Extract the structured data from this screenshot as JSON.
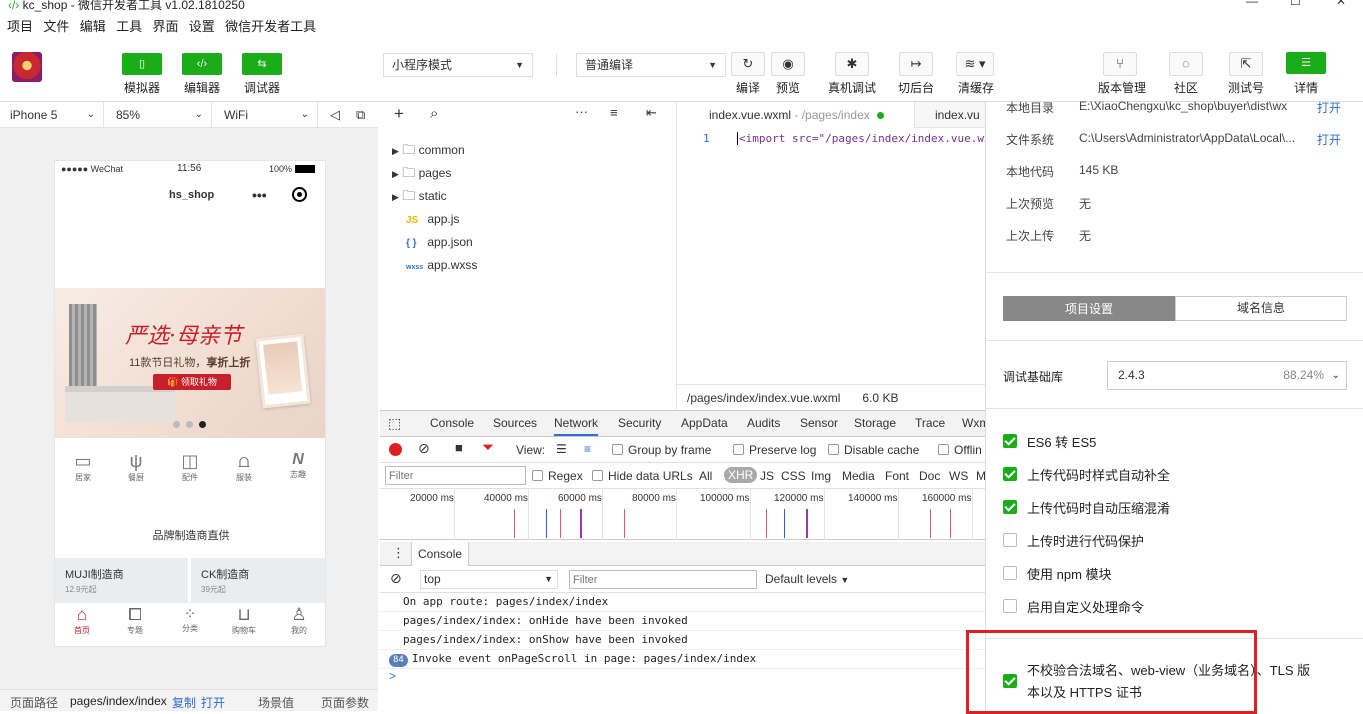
{
  "window": {
    "title": "kc_shop - 微信开发者工具 v1.02.1810250"
  },
  "menu": [
    "项目",
    "文件",
    "编辑",
    "工具",
    "界面",
    "设置",
    "微信开发者工具"
  ],
  "toolbar": {
    "simulator_label": "模拟器",
    "editor_label": "编辑器",
    "debugger_label": "调试器",
    "mode_select": "小程序模式",
    "compile_select": "普通编译",
    "compile_label": "编译",
    "preview_label": "预览",
    "remote_debug_label": "真机调试",
    "background_label": "切后台",
    "clear_cache_label": "清缓存",
    "version_label": "版本管理",
    "community_label": "社区",
    "test_account_label": "测试号",
    "details_label": "详情"
  },
  "simulator": {
    "device": "iPhone 5",
    "zoom": "85%",
    "network": "WiFi",
    "phone": {
      "carrier": "●●●●● WeChat",
      "time": "11:56",
      "battery": "100%",
      "nav_title": "hs_shop",
      "banner_title": "严选·母亲节",
      "banner_sub_prefix": "11款节日礼物，",
      "banner_sub_bold": "享折上折",
      "banner_button": "领取礼物",
      "categories": [
        "居家",
        "餐厨",
        "配件",
        "服装",
        "志趣"
      ],
      "brand_title": "品牌制造商直供",
      "brand_cards": [
        {
          "name": "MUJI制造商",
          "price": "12.9元起"
        },
        {
          "name": "CK制造商",
          "price": "39元起"
        }
      ],
      "tabs": [
        "首页",
        "专题",
        "分类",
        "购物车",
        "我的"
      ]
    }
  },
  "statusbar": {
    "path_label": "页面路径",
    "path_value": "pages/index/index",
    "copy": "复制",
    "open": "打开",
    "scene": "场景值",
    "params": "页面参数"
  },
  "files": {
    "folders": [
      "common",
      "pages",
      "static"
    ],
    "files": [
      {
        "name": "app.js",
        "badge": "JS"
      },
      {
        "name": "app.json",
        "badge": "{ }"
      },
      {
        "name": "app.wxss",
        "badge": "wxss"
      }
    ]
  },
  "editor": {
    "tab1_name": "index.vue.wxml",
    "tab1_path": " - /pages/index",
    "tab2_name": "index.vu",
    "line_number": "1",
    "code": "<import src=\"/pages/index/index.vue.wx",
    "status_path": "/pages/index/index.vue.wxml",
    "status_size": "6.0 KB"
  },
  "devtools": {
    "tabs": [
      "Console",
      "Sources",
      "Network",
      "Security",
      "AppData",
      "Audits",
      "Sensor",
      "Storage",
      "Trace",
      "Wxm"
    ],
    "active_tab": "Network",
    "view_label": "View:",
    "group_by_frame": "Group by frame",
    "preserve_log": "Preserve log",
    "disable_cache": "Disable cache",
    "offline": "Offlin",
    "filter_placeholder": "Filter",
    "regex": "Regex",
    "hide_data_urls": "Hide data URLs",
    "types": [
      "All",
      "XHR",
      "JS",
      "CSS",
      "Img",
      "Media",
      "Font",
      "Doc",
      "WS",
      "M"
    ],
    "timeline_ticks": [
      "20000 ms",
      "40000 ms",
      "60000 ms",
      "80000 ms",
      "100000 ms",
      "120000 ms",
      "140000 ms",
      "160000 ms"
    ],
    "console_tab": "Console",
    "context": "top",
    "console_filter_placeholder": "Filter",
    "levels": "Default levels",
    "logs": [
      "On app route: pages/index/index",
      "pages/index/index: onHide have been invoked",
      "pages/index/index: onShow have been invoked",
      "Invoke event onPageScroll in page: pages/index/index"
    ],
    "log_count": "84",
    "prompt": ">"
  },
  "details": {
    "info": [
      {
        "label": "本地目录",
        "value": "E:\\XiaoChengxu\\kc_shop\\buyer\\dist\\wx",
        "action": "打开"
      },
      {
        "label": "文件系统",
        "value": "C:\\Users\\Administrator\\AppData\\Local\\...",
        "action": "打开"
      },
      {
        "label": "本地代码",
        "value": "145 KB"
      },
      {
        "label": "上次预览",
        "value": "无"
      },
      {
        "label": "上次上传",
        "value": "无"
      }
    ],
    "tab_project": "项目设置",
    "tab_domain": "域名信息",
    "base_lib_label": "调试基础库",
    "base_lib_version": "2.4.3",
    "base_lib_percent": "88.24%",
    "settings": [
      {
        "label": "ES6 转 ES5",
        "checked": true
      },
      {
        "label": "上传代码时样式自动补全",
        "checked": true
      },
      {
        "label": "上传代码时自动压缩混淆",
        "checked": true
      },
      {
        "label": "上传时进行代码保护",
        "checked": false
      },
      {
        "label": "使用 npm 模块",
        "checked": false
      },
      {
        "label": "启用自定义处理命令",
        "checked": false
      }
    ],
    "domain_check_line1": "不校验合法域名、web-view（业务域名）、TLS 版",
    "domain_check_line2": "本以及 HTTPS 证书"
  },
  "colors": {
    "green": "#1aad19",
    "highlight_red": "#e02020",
    "link_blue": "#2e6cd6"
  }
}
